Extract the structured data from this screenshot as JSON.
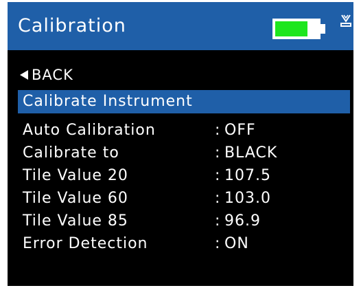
{
  "header": {
    "title": "Calibration",
    "battery_level": 0.75,
    "battery_color": "#1ee61e",
    "header_color": "#1f5fa8",
    "usb_icon": "usb-charging-icon"
  },
  "nav": {
    "back_icon": "left-triangle-icon",
    "back_label": "BACK"
  },
  "section": {
    "title": "Calibrate Instrument"
  },
  "settings": [
    {
      "label": "Auto Calibration",
      "separator": ":",
      "value": "OFF"
    },
    {
      "label": "Calibrate to",
      "separator": ":",
      "value": "BLACK"
    },
    {
      "label": "Tile Value 20",
      "separator": ":",
      "value": "107.5"
    },
    {
      "label": "Tile Value 60",
      "separator": ":",
      "value": "103.0"
    },
    {
      "label": "Tile Value 85",
      "separator": ":",
      "value": "96.9"
    },
    {
      "label": "Error Detection",
      "separator": ":",
      "value": "ON"
    }
  ]
}
